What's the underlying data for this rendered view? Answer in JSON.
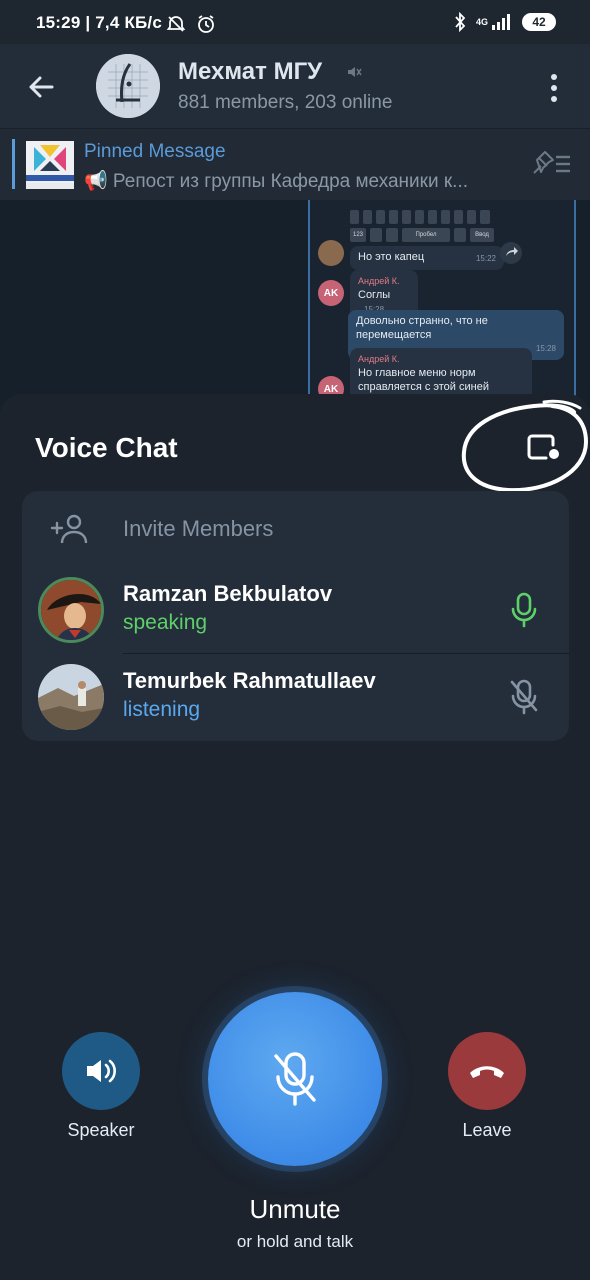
{
  "status_bar": {
    "time_speed": "15:29 | 7,4 КБ/с",
    "network": "4G",
    "battery": "42"
  },
  "header": {
    "title": "Мехмат МГУ",
    "subtitle": "881 members, 203 online"
  },
  "pinned": {
    "title": "Pinned Message",
    "text": "📢 Репост из группы Кафедра механики к..."
  },
  "background_chat": {
    "messages": [
      {
        "text": "Но это капец",
        "time": "15:22"
      },
      {
        "sender": "Андрей К.",
        "text": "Соглы",
        "time": "15:28"
      },
      {
        "text": "Довольно странно, что не перемещается",
        "time": "15:28"
      },
      {
        "sender": "Андрей К.",
        "text": "Но главное меню норм справляется с этой синей кнопкой"
      }
    ],
    "avatar_initials": "AK",
    "keyboard": {
      "label_space": "Пробел",
      "label_enter": "Ввод",
      "label_123": "123"
    }
  },
  "voice_chat": {
    "title": "Voice Chat",
    "invite_label": "Invite Members",
    "participants": [
      {
        "name": "Ramzan Bekbulatov",
        "status": "speaking",
        "status_color": "#5ed06a",
        "mic": "on"
      },
      {
        "name": "Temurbek Rahmatullaev",
        "status": "listening",
        "status_color": "#5aa8ee",
        "mic": "muted"
      }
    ]
  },
  "controls": {
    "speaker_label": "Speaker",
    "leave_label": "Leave",
    "unmute_label": "Unmute",
    "hold_label": "or hold and talk"
  },
  "colors": {
    "speaker_button": "#1f5a87",
    "leave_button": "#9b3a3d",
    "mic_button": "#3d8be8",
    "accent_blue": "#5a9bd8"
  }
}
